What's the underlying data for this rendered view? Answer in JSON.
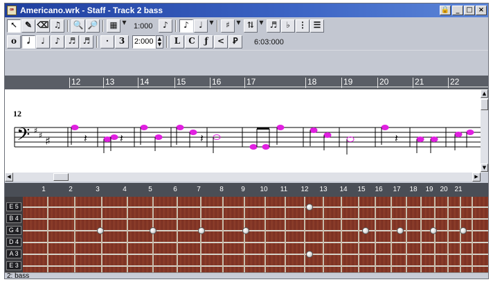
{
  "window": {
    "title": "Americano.wrk - Staff - Track 2 bass",
    "app_icon": "cakewalk-app-icon",
    "controls": [
      "lock-icon",
      "minimize-icon",
      "maximize-icon",
      "close-icon"
    ]
  },
  "toolbar1": {
    "tools": [
      "select-arrow-icon",
      "pencil-icon",
      "eraser-icon",
      "scrub-icon",
      "zoom-in-icon",
      "zoom-out-icon",
      "grid-icon"
    ],
    "time_value": "1:000",
    "right_tools": [
      "note-tool-icon",
      "note-duration-icon",
      "dropdown-icon",
      "chord-icon",
      "transpose-icon",
      "lyric-icon",
      "fretboard-icon",
      "score-icon"
    ]
  },
  "toolbar2": {
    "durations": [
      "whole-note-icon",
      "half-note-icon",
      "quarter-note-icon",
      "eighth-note-icon",
      "sixteenth-note-icon",
      "thirtysecond-note-icon"
    ],
    "dot_label": "·",
    "triplet_label": "3",
    "snap_value": "2:000",
    "articulations": [
      "L",
      "C",
      "ƒ",
      "<",
      "Ꝑ"
    ],
    "position_readout": "6:03:000"
  },
  "ruler": {
    "measures": [
      "12",
      "13",
      "14",
      "15",
      "16",
      "17",
      "18",
      "19",
      "20",
      "21",
      "22"
    ]
  },
  "staff": {
    "measure_label": "12",
    "clef": "bass-clef",
    "key_signature": "2 sharps (D major)",
    "note_color": "#e020e0"
  },
  "fretboard": {
    "fret_numbers": [
      "1",
      "2",
      "3",
      "4",
      "5",
      "6",
      "7",
      "8",
      "9",
      "10",
      "11",
      "12",
      "13",
      "14",
      "15",
      "16",
      "17",
      "18",
      "19",
      "20",
      "21"
    ],
    "strings": [
      "E 5",
      "B 4",
      "G 4",
      "D 4",
      "A 3",
      "E 3"
    ]
  },
  "status": {
    "text": "2: bass"
  }
}
